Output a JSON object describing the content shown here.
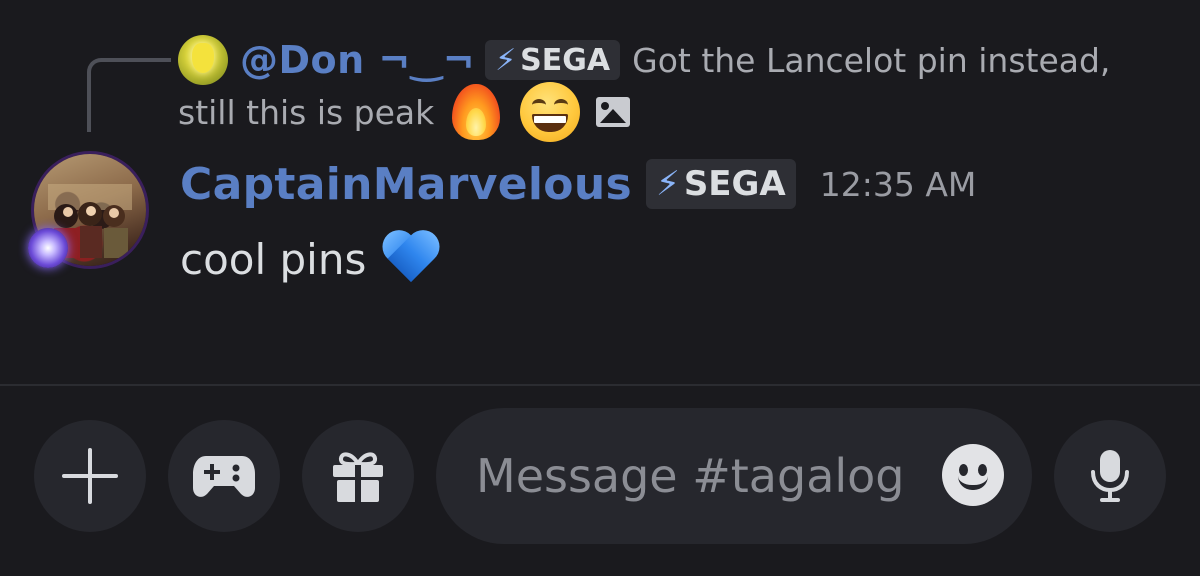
{
  "reply": {
    "username": "@Don ¬‿¬",
    "tag": "SEGA",
    "tag_icon": "⚡",
    "text_line1": "Got the Lancelot pin instead,",
    "text_line2": "still this is peak",
    "emojis": [
      "fire-emoji",
      "grinning-face-emoji"
    ],
    "attachment_icon": "image-icon"
  },
  "message": {
    "username": "CaptainMarvelous",
    "tag": "SEGA",
    "tag_icon": "⚡",
    "timestamp": "12:35 AM",
    "text": "cool pins",
    "emoji": "blue-heart-emoji"
  },
  "composer": {
    "placeholder": "Message #tagalog",
    "buttons": [
      "plus-icon",
      "gamepad-icon",
      "gift-icon",
      "microphone-icon"
    ],
    "emoji_button": "smile-icon"
  },
  "colors": {
    "background": "#1a1a1e",
    "username": "#5a7fc4",
    "control_bg": "#26272d"
  }
}
